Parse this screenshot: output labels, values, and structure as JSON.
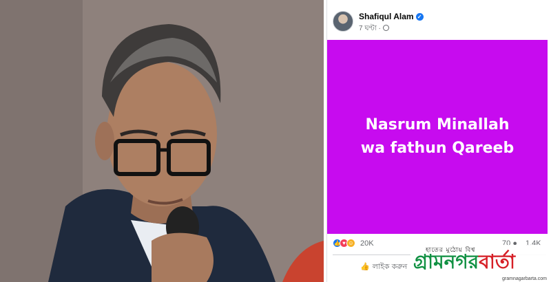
{
  "post": {
    "author": "Shafiqul Alam",
    "time": "7 ঘণ্টা",
    "status_text": "Nasrum Minallah wa fathun Qareeb",
    "status_bg": "#c70bef",
    "reactions_count": "20K",
    "comments_count": "70",
    "shares_count": "1.4K",
    "like_label": "লাইক করুন",
    "icons": [
      "verified-badge-icon",
      "globe-icon",
      "like-reaction-icon",
      "love-reaction-icon",
      "haha-reaction-icon",
      "comment-icon",
      "thumbs-up-icon"
    ]
  },
  "watermark": {
    "tagline": "হাতের মুঠোয় বিশ্ব",
    "logo_part1": "গ্রামনগর",
    "logo_part2": "বার্তা",
    "url": "gramnagarbarta.com",
    "colors": {
      "green": "#119143",
      "red": "#d61f26"
    }
  }
}
